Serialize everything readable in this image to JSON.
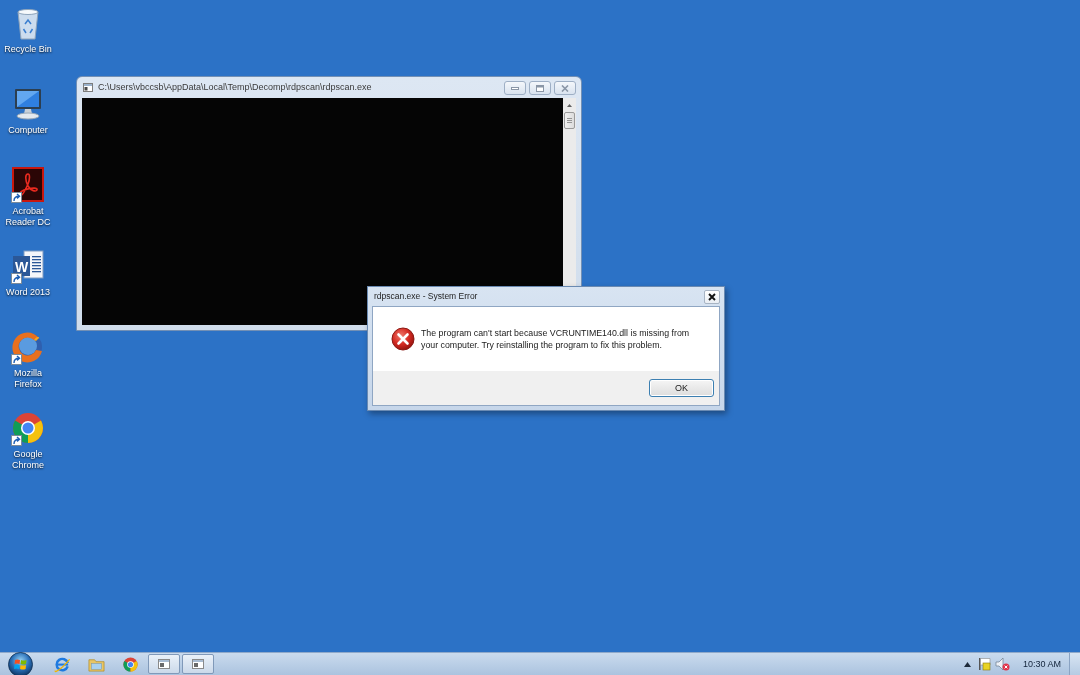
{
  "desktop_icons": [
    {
      "label": "Recycle Bin",
      "kind": "recycle-bin",
      "shortcut": false
    },
    {
      "label": "Computer",
      "kind": "computer",
      "shortcut": false
    },
    {
      "label": "Acrobat Reader DC",
      "kind": "acrobat",
      "shortcut": true
    },
    {
      "label": "Word 2013",
      "kind": "word",
      "shortcut": true,
      "logo_text": "W"
    },
    {
      "label": "Mozilla Firefox",
      "kind": "firefox",
      "shortcut": true
    },
    {
      "label": "Google Chrome",
      "kind": "chrome",
      "shortcut": true
    }
  ],
  "console_window": {
    "title": "C:\\Users\\vbccsb\\AppData\\Local\\Temp\\Decomp\\rdpscan\\rdpscan.exe"
  },
  "error_dialog": {
    "title": "rdpscan.exe - System Error",
    "message": "The program can't start because VCRUNTIME140.dll is missing from your computer. Try reinstalling the program to fix this problem.",
    "buttons": [
      "OK"
    ]
  },
  "taskbar": {
    "pinned": [
      {
        "kind": "ie"
      },
      {
        "kind": "explorer"
      },
      {
        "kind": "chrome"
      }
    ],
    "windows": [
      {
        "kind": "app-window"
      },
      {
        "kind": "app-window"
      }
    ],
    "tray": [
      {
        "kind": "overflow"
      },
      {
        "kind": "action-center"
      },
      {
        "kind": "volume",
        "muted": true
      }
    ],
    "clock": "10:30 AM"
  }
}
